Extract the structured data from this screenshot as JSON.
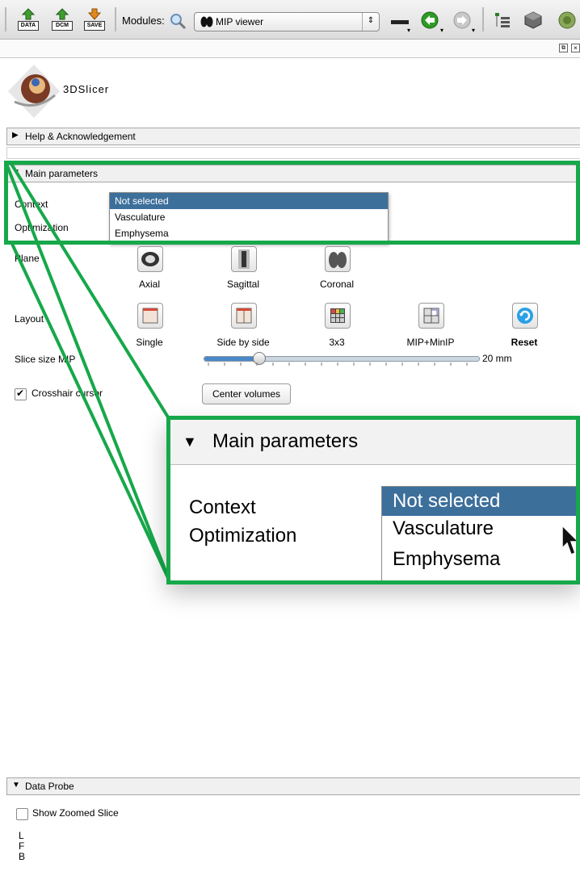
{
  "toolbar": {
    "data_label": "DATA",
    "dcm_label": "DCM",
    "save_label": "SAVE",
    "modules_label": "Modules:",
    "module_selected": "MIP viewer"
  },
  "logo": {
    "text": "3DSlicer"
  },
  "sections": {
    "help": "Help & Acknowledgement",
    "main": "Main parameters",
    "data_probe": "Data Probe"
  },
  "main": {
    "context_label": "Context",
    "optimization_label": "Optimization",
    "plane_label": "Plane",
    "layout_label": "Layout",
    "slice_label": "Slice size MIP",
    "crosshair_label": "Crosshair cursor",
    "crosshair_checked": true,
    "context_options": [
      "Not selected",
      "Vasculature",
      "Emphysema"
    ],
    "context_selected_index": 0,
    "planes": [
      "Axial",
      "Sagittal",
      "Coronal"
    ],
    "layouts": [
      "Single",
      "Side by side",
      "3x3",
      "MIP+MinIP",
      "Reset"
    ],
    "slice_value": "20 mm",
    "slice_fraction": 0.2,
    "center_button": "Center volumes"
  },
  "zoom": {
    "section": "Main parameters",
    "context_label": "Context",
    "optimization_label": "Optimization",
    "options": [
      "Not selected",
      "Vasculature",
      "Emphysema"
    ]
  },
  "data_probe": {
    "show_zoomed": "Show Zoomed Slice",
    "coords": [
      "L",
      "F",
      "B"
    ]
  },
  "colors": {
    "highlight": "#16a84a",
    "selected": "#3d6f9b"
  }
}
